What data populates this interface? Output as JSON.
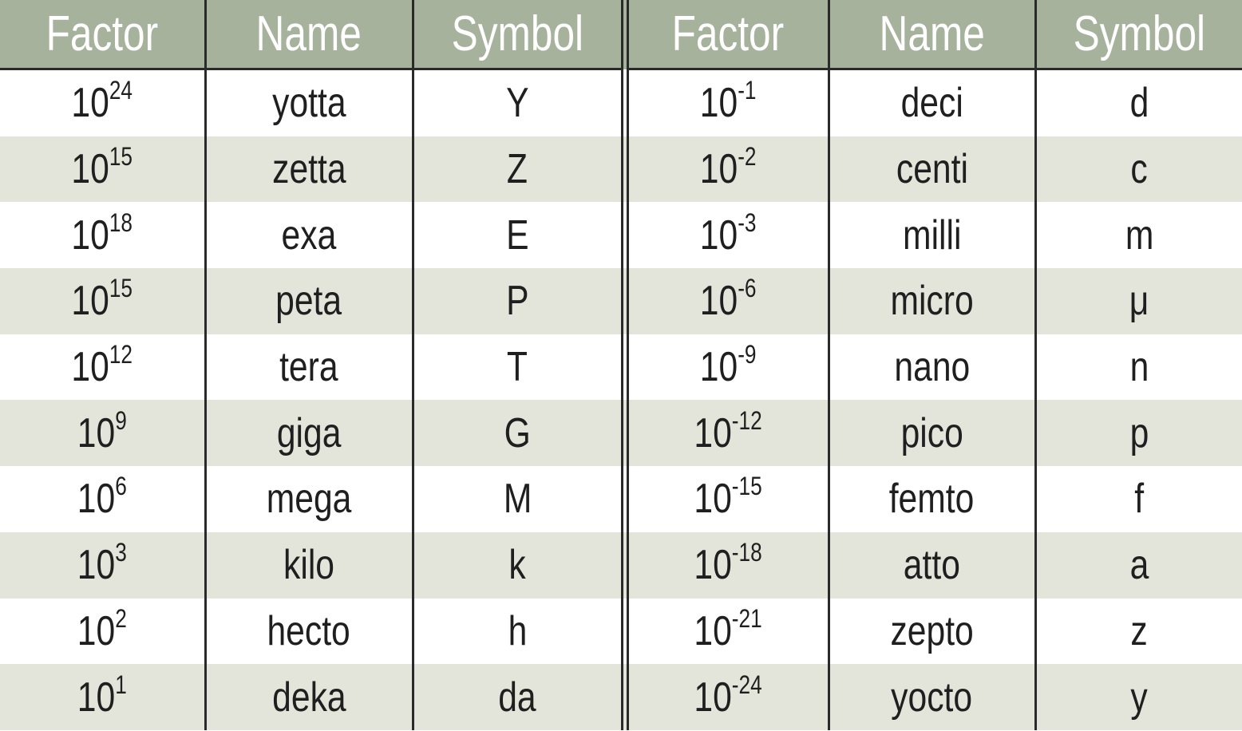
{
  "headers": [
    "Factor",
    "Name",
    "Symbol",
    "Factor",
    "Name",
    "Symbol"
  ],
  "colors": {
    "header_bg": "#a6b29c",
    "stripe": "#e3e5da",
    "border": "#2a2a2a"
  },
  "rows": [
    {
      "l_base": "10",
      "l_exp": "24",
      "l_name": "yotta",
      "l_sym": "Y",
      "r_base": "10",
      "r_exp": "-1",
      "r_name": "deci",
      "r_sym": "d"
    },
    {
      "l_base": "10",
      "l_exp": "15",
      "l_name": "zetta",
      "l_sym": "Z",
      "r_base": "10",
      "r_exp": "-2",
      "r_name": "centi",
      "r_sym": "c"
    },
    {
      "l_base": "10",
      "l_exp": "18",
      "l_name": "exa",
      "l_sym": "E",
      "r_base": "10",
      "r_exp": "-3",
      "r_name": "milli",
      "r_sym": "m"
    },
    {
      "l_base": "10",
      "l_exp": "15",
      "l_name": "peta",
      "l_sym": "P",
      "r_base": "10",
      "r_exp": "-6",
      "r_name": "micro",
      "r_sym": "μ"
    },
    {
      "l_base": "10",
      "l_exp": "12",
      "l_name": "tera",
      "l_sym": "T",
      "r_base": "10",
      "r_exp": "-9",
      "r_name": "nano",
      "r_sym": "n"
    },
    {
      "l_base": "10",
      "l_exp": "9",
      "l_name": "giga",
      "l_sym": "G",
      "r_base": "10",
      "r_exp": "-12",
      "r_name": "pico",
      "r_sym": "p"
    },
    {
      "l_base": "10",
      "l_exp": "6",
      "l_name": "mega",
      "l_sym": "M",
      "r_base": "10",
      "r_exp": "-15",
      "r_name": "femto",
      "r_sym": "f"
    },
    {
      "l_base": "10",
      "l_exp": "3",
      "l_name": "kilo",
      "l_sym": "k",
      "r_base": "10",
      "r_exp": "-18",
      "r_name": "atto",
      "r_sym": "a"
    },
    {
      "l_base": "10",
      "l_exp": "2",
      "l_name": "hecto",
      "l_sym": "h",
      "r_base": "10",
      "r_exp": "-21",
      "r_name": "zepto",
      "r_sym": "z"
    },
    {
      "l_base": "10",
      "l_exp": "1",
      "l_name": "deka",
      "l_sym": "da",
      "r_base": "10",
      "r_exp": "-24",
      "r_name": "yocto",
      "r_sym": "y"
    }
  ]
}
